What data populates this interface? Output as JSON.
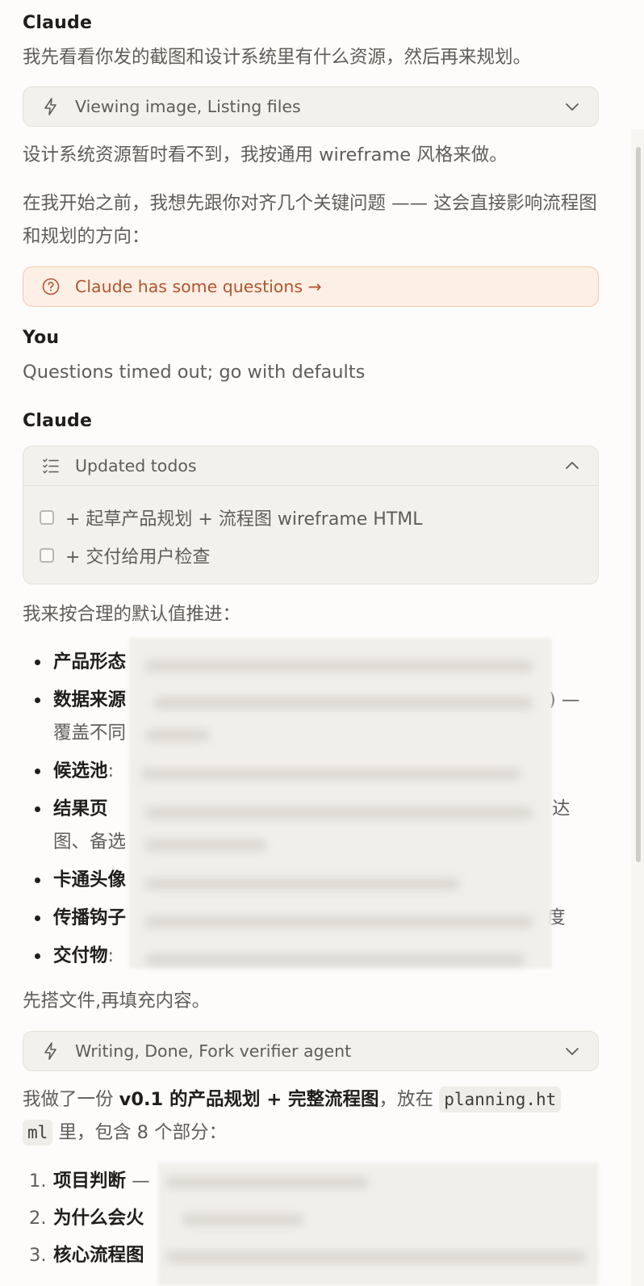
{
  "colors": {
    "accent": "#b0552e",
    "text": "#1f1e1d",
    "muted": "#5e5d59",
    "card": "#f2f1ec"
  },
  "msg1": {
    "speaker": "Claude",
    "intro": "我先看看你发的截图和设计系统里有什么资源，然后再来规划。",
    "tool1": {
      "label": "Viewing image, Listing files",
      "icon": "lightning-icon"
    },
    "p1": "设计系统资源暂时看不到，我按通用 wireframe 风格来做。",
    "p2": "在我开始之前，我想先跟你对齐几个关键问题 —— 这会直接影响流程图和规划的方向：",
    "questions": {
      "label": "Claude has some questions →",
      "icon": "question-circle-icon"
    }
  },
  "msg2": {
    "speaker": "You",
    "text": "Questions timed out; go with defaults"
  },
  "msg3": {
    "speaker": "Claude",
    "todos": {
      "title": "Updated todos",
      "items": [
        "+ 起草产品规划 + 流程图 wireframe HTML",
        "+ 交付给用户检查"
      ]
    },
    "lead": "我来按合理的默认值推进：",
    "bullets": [
      {
        "label": "产品形态",
        "tail": ""
      },
      {
        "label": "数据来源",
        "tail": ") —",
        "cont": "覆盖不同"
      },
      {
        "label": "候选池",
        "tail": ": "
      },
      {
        "label": "结果页",
        "tail": "达",
        "cont": "图、备选"
      },
      {
        "label": "卡通头像",
        "tail": ""
      },
      {
        "label": "传播钩子",
        "tail": "度"
      },
      {
        "label": "交付物",
        "tail": ": "
      }
    ],
    "after": "先搭文件,再填充内容。",
    "tool2": {
      "label": "Writing, Done, Fork verifier agent",
      "icon": "lightning-icon"
    },
    "summary": {
      "pre": "我做了一份 ",
      "bold": "v0.1 的产品规划 + 完整流程图",
      "mid": "，放在 ",
      "code1": "planning.ht",
      "code2": "ml",
      "post": " 里，包含 8 个部分："
    },
    "numbered": [
      {
        "n": "1.",
        "label": "项目判断",
        "tail": " —"
      },
      {
        "n": "2.",
        "label": "为什么会火",
        "tail": ""
      },
      {
        "n": "3.",
        "label": "核心流程图",
        "tail": ""
      }
    ]
  }
}
